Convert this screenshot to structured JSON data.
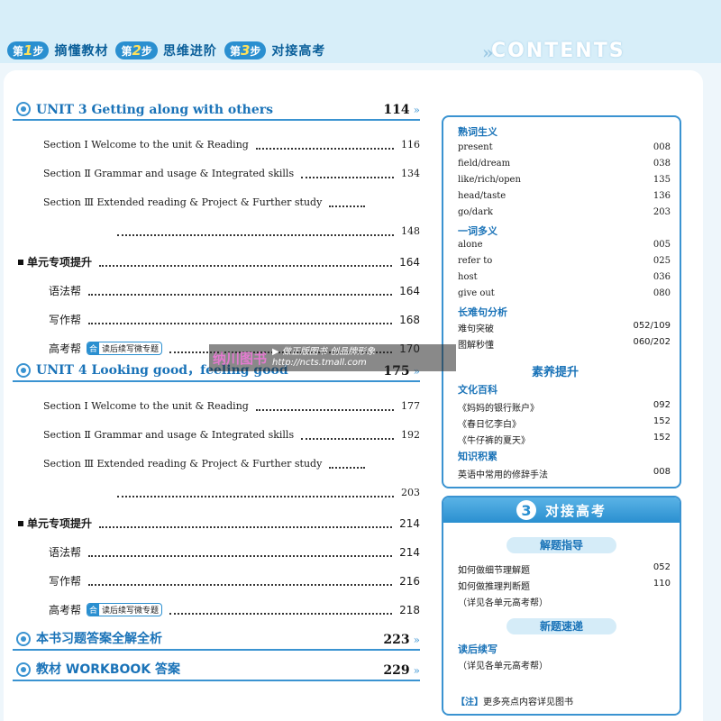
{
  "header": {
    "steps": [
      {
        "prefix": "第",
        "num": "1",
        "suffix": "步",
        "title": "摘懂教材"
      },
      {
        "prefix": "第",
        "num": "2",
        "suffix": "步",
        "title": "思维进阶"
      },
      {
        "prefix": "第",
        "num": "3",
        "suffix": "步",
        "title": "对接高考"
      }
    ],
    "contents_label": "CONTENTS",
    "arrow": "»"
  },
  "units": [
    {
      "title": "UNIT 3 Getting along with others",
      "page": "114",
      "sections": [
        {
          "label": "Section Ⅰ  Welcome to the unit & Reading",
          "page": "116"
        },
        {
          "label": "Section Ⅱ  Grammar and usage & Integrated skills",
          "page": "134"
        },
        {
          "label": "Section Ⅲ  Extended reading & Project & Further study",
          "page": "148"
        }
      ],
      "special": {
        "label": "单元专项提升",
        "page": "164"
      },
      "items": [
        {
          "label": "语法帮",
          "page": "164"
        },
        {
          "label": "写作帮",
          "page": "168"
        },
        {
          "label": "高考帮",
          "tag_icon": "合",
          "tag_text": "读后续写微专题",
          "page": "170"
        }
      ]
    },
    {
      "title": "UNIT 4 Looking good，feeling good",
      "page": "175",
      "sections": [
        {
          "label": "Section Ⅰ  Welcome to the unit & Reading",
          "page": "177"
        },
        {
          "label": "Section Ⅱ  Grammar and usage & Integrated skills",
          "page": "192"
        },
        {
          "label": "Section Ⅲ  Extended reading & Project & Further study",
          "page": "203"
        }
      ],
      "special": {
        "label": "单元专项提升",
        "page": "214"
      },
      "items": [
        {
          "label": "语法帮",
          "page": "214"
        },
        {
          "label": "写作帮",
          "page": "216"
        },
        {
          "label": "高考帮",
          "tag_icon": "合",
          "tag_text": "读后续写微专题",
          "page": "218"
        }
      ]
    }
  ],
  "extras": [
    {
      "title": "本书习题答案全解全析",
      "page": "223"
    },
    {
      "title": "教材 WORKBOOK 答案",
      "page": "229"
    }
  ],
  "sidebar": {
    "familiar_words": {
      "title": "熟词生义",
      "items": [
        {
          "word": "present",
          "page": "008"
        },
        {
          "word": "field/dream",
          "page": "038"
        },
        {
          "word": "like/rich/open",
          "page": "135"
        },
        {
          "word": "head/taste",
          "page": "136"
        },
        {
          "word": "go/dark",
          "page": "203"
        }
      ]
    },
    "polysemy": {
      "title": "一词多义",
      "items": [
        {
          "word": "alone",
          "page": "005"
        },
        {
          "word": "refer to",
          "page": "025"
        },
        {
          "word": "host",
          "page": "036"
        },
        {
          "word": "give out",
          "page": "080"
        }
      ]
    },
    "long_sentences": {
      "title": "长难句分析",
      "items": [
        {
          "word": "难句突破",
          "page": "052/109"
        },
        {
          "word": "图解秒懂",
          "page": "060/202"
        }
      ]
    },
    "literacy_label": "素养提升",
    "culture": {
      "title": "文化百科",
      "items": [
        {
          "word": "《妈妈的银行账户》",
          "page": "092"
        },
        {
          "word": "《春日忆李白》",
          "page": "152"
        },
        {
          "word": "《牛仔裤的夏天》",
          "page": "152"
        }
      ]
    },
    "knowledge": {
      "title": "知识积累",
      "items": [
        {
          "word": "英语中常用的修辞手法",
          "page": "008"
        }
      ]
    },
    "exam": {
      "badge": "3",
      "title": "对接高考",
      "guide_label": "解题指导",
      "guide_items": [
        {
          "word": "如何做细节理解题",
          "page": "052"
        },
        {
          "word": "如何做推理判断题",
          "page": "110"
        },
        {
          "word": "（详见各单元高考帮）",
          "page": ""
        }
      ],
      "new_label": "新题速递",
      "new_title": "读后续写",
      "new_note": "（详见各单元高考帮）",
      "note_bracket": "【注】",
      "note_text": "更多亮点内容详见图书"
    }
  },
  "watermark": {
    "logo": "纳川图书",
    "line1": "▶ 做正版图书 创品牌形象",
    "line2": "http://ncts.tmall.com"
  }
}
